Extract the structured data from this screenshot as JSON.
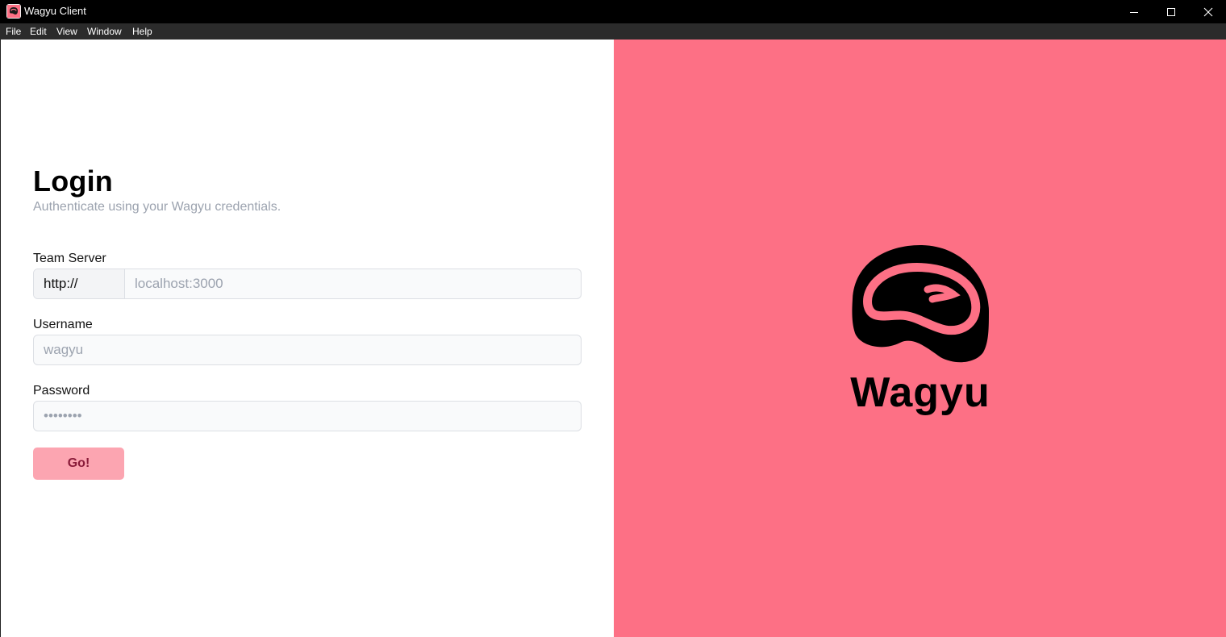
{
  "window": {
    "title": "Wagyu Client",
    "icon": "wagyu-app-icon",
    "controls": [
      "minimize-icon",
      "maximize-icon",
      "close-icon"
    ]
  },
  "menu": {
    "items": [
      {
        "label": "File"
      },
      {
        "label": "Edit"
      },
      {
        "label": "View"
      },
      {
        "label": "Window"
      },
      {
        "label": "Help"
      }
    ]
  },
  "login": {
    "title": "Login",
    "subtitle": "Authenticate using your Wagyu credentials.",
    "team_server": {
      "label": "Team Server",
      "prefix": "http://",
      "value": "",
      "placeholder": "localhost:3000"
    },
    "username": {
      "label": "Username",
      "value": "",
      "placeholder": "wagyu"
    },
    "password": {
      "label": "Password",
      "value": "",
      "placeholder": "••••••••"
    },
    "submit_label": "Go!"
  },
  "brand": {
    "name": "Wagyu",
    "logo_icon": "steak-icon"
  },
  "colors": {
    "titlebar": "#000000",
    "menubar": "#2b2b2b",
    "brand_panel": "#fd7085",
    "button_bg": "#fca5b1",
    "button_text": "#8a1c3a",
    "subtitle_text": "#9ca3af"
  }
}
